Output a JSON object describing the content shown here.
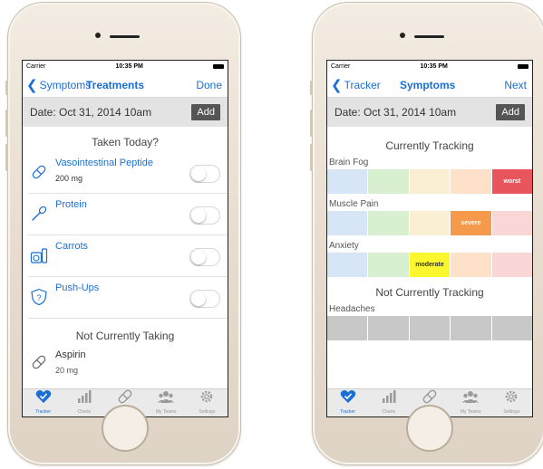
{
  "left_phone": {
    "status": {
      "carrier": "Carrier",
      "time": "10:35 PM"
    },
    "nav": {
      "back_label": "Symptoms",
      "title": "Treatments",
      "right_label": "Done"
    },
    "date_bar": {
      "date_text": "Date: Oct 31, 2014 10am",
      "add_label": "Add"
    },
    "taken_header": "Taken Today?",
    "treatments": [
      {
        "name": "Vasointestinal Peptide",
        "dose": "200 mg",
        "icon": "pill-icon",
        "on": false
      },
      {
        "name": "Protein",
        "dose": "",
        "icon": "spoon-icon",
        "on": false
      },
      {
        "name": "Carrots",
        "dose": "",
        "icon": "food-icon",
        "on": false
      },
      {
        "name": "Push-Ups",
        "dose": "",
        "icon": "exercise-icon",
        "on": false
      }
    ],
    "not_taking_header": "Not Currently Taking",
    "not_taking": [
      {
        "name": "Aspirin",
        "dose": "20 mg",
        "icon": "pill-icon"
      }
    ]
  },
  "right_phone": {
    "status": {
      "carrier": "Carrier",
      "time": "10:35 PM"
    },
    "nav": {
      "back_label": "Tracker",
      "title": "Symptoms",
      "right_label": "Next"
    },
    "date_bar": {
      "date_text": "Date: Oct 31, 2014 10am",
      "add_label": "Add"
    },
    "tracking_header": "Currently Tracking",
    "symptoms": [
      {
        "name": "Brain Fog",
        "level_index": 4,
        "level_label": "worst"
      },
      {
        "name": "Muscle Pain",
        "level_index": 3,
        "level_label": "severe"
      },
      {
        "name": "Anxiety",
        "level_index": 2,
        "level_label": "moderate"
      }
    ],
    "not_tracking_header": "Not Currently Tracking",
    "not_tracking": [
      {
        "name": "Headaches"
      }
    ]
  },
  "tabbar": [
    {
      "label": "Tracker",
      "icon": "heart-check-icon"
    },
    {
      "label": "Charts",
      "icon": "bar-chart-icon"
    },
    {
      "label": "Treatments",
      "icon": "pill-icon"
    },
    {
      "label": "My Teams",
      "icon": "team-icon"
    },
    {
      "label": "Settings",
      "icon": "gear-icon"
    }
  ],
  "colors": {
    "accent": "#1a6fd4",
    "severity_pale": [
      "#d7e6f7",
      "#d8efd0",
      "#fbefd3",
      "#fde2c9",
      "#fbd6d6"
    ],
    "severity_bright": [
      "#4aa3e6",
      "#7ac95c",
      "#fbf72f",
      "#f49a4a",
      "#e8555c"
    ],
    "inactive": "#c8c8c8"
  }
}
